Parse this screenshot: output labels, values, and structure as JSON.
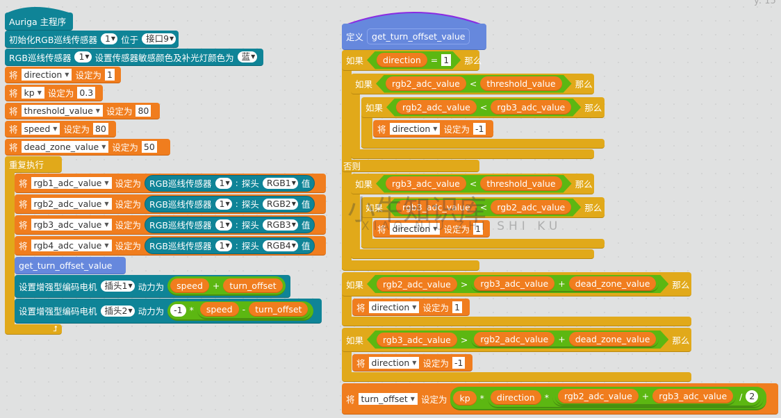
{
  "coords": "y: 15",
  "watermark": {
    "cn": "小牛知识库",
    "en": "XIAO NIU ZHI SHI KU"
  },
  "colors": {
    "teal": "#0f8497",
    "orange": "#f07d1e",
    "gold": "#e1a91a",
    "custom": "#6688dd",
    "operator": "#5cb712",
    "background": "#e0e1e1"
  },
  "left": {
    "hat": "Auriga 主程序",
    "init": {
      "a": "初始化RGB巡线传感器",
      "sensor": "1",
      "b": "位于",
      "port": "接口9"
    },
    "color": {
      "a": "RGB巡线传感器",
      "sensor": "1",
      "b": "设置传感器敏感颜色及补光灯颜色为",
      "color": "蓝"
    },
    "set_word": "将",
    "to_word": "设定为",
    "sets": [
      {
        "var": "direction",
        "val": "1"
      },
      {
        "var": "kp",
        "val": "0.3"
      },
      {
        "var": "threshold_value",
        "val": "80"
      },
      {
        "var": "speed",
        "val": "80"
      },
      {
        "var": "dead_zone_value",
        "val": "50"
      }
    ],
    "forever": "重复执行",
    "reads": [
      {
        "var": "rgb1_adc_value",
        "probe": "RGB1"
      },
      {
        "var": "rgb2_adc_value",
        "probe": "RGB2"
      },
      {
        "var": "rgb3_adc_value",
        "probe": "RGB3"
      },
      {
        "var": "rgb4_adc_value",
        "probe": "RGB4"
      }
    ],
    "read_parts": {
      "sensor_label": "RGB巡线传感器",
      "sensor": "1",
      "colon": ":",
      "probe_label": "探头",
      "value_label": "值"
    },
    "call": "get_turn_offset_value",
    "motor_label": "设置增强型编码电机",
    "power_label": "动力为",
    "motor1": {
      "port": "插头1",
      "a": "speed",
      "op": "+",
      "b": "turn_offset"
    },
    "motor2": {
      "port": "插头2",
      "neg": "-1",
      "mul": "*",
      "a": "speed",
      "op": "-",
      "b": "turn_offset"
    }
  },
  "right": {
    "define": "定义",
    "name": "get_turn_offset_value",
    "if": "如果",
    "then": "那么",
    "else": "否则",
    "set": "将",
    "to": "设定为",
    "if1": {
      "a": "direction",
      "op": "=",
      "b": "1"
    },
    "if2": {
      "a": "rgb2_adc_value",
      "op": "<",
      "b": "threshold_value"
    },
    "if3": {
      "a": "rgb2_adc_value",
      "op": "<",
      "b": "rgb3_adc_value"
    },
    "set1": {
      "var": "direction",
      "val": "-1"
    },
    "if4": {
      "a": "rgb3_adc_value",
      "op": "<",
      "b": "threshold_value"
    },
    "if5": {
      "a": "rgb3_adc_value",
      "op": "<",
      "b": "rgb2_adc_value"
    },
    "set2": {
      "var": "direction",
      "val": "1"
    },
    "if6": {
      "a": "rgb2_adc_value",
      "op": ">",
      "b": "rgb3_adc_value",
      "plus": "+",
      "c": "dead_zone_value"
    },
    "set3": {
      "var": "direction",
      "val": "1"
    },
    "if7": {
      "a": "rgb3_adc_value",
      "op": ">",
      "b": "rgb2_adc_value",
      "plus": "+",
      "c": "dead_zone_value"
    },
    "set4": {
      "var": "direction",
      "val": "-1"
    },
    "final": {
      "var": "turn_offset",
      "kp": "kp",
      "mul": "*",
      "dir": "direction",
      "mul2": "*",
      "a": "rgb2_adc_value",
      "plus": "+",
      "b": "rgb3_adc_value",
      "div": "/",
      "n": "2"
    }
  }
}
